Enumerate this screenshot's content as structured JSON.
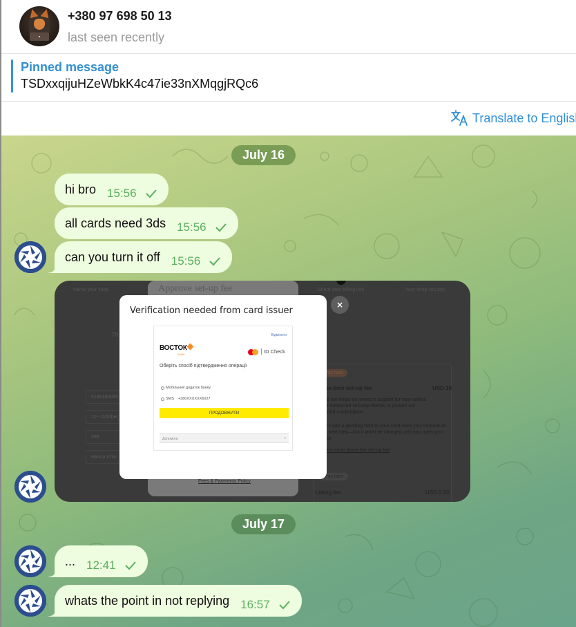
{
  "header": {
    "contact_name": "+380 97 698 50 13",
    "status": "last seen recently"
  },
  "pinned": {
    "title": "Pinned message",
    "text": "TSDxxqijuHZeWbkK4c47ie33nXMqgjRQc6"
  },
  "translate": {
    "label": "Translate to English"
  },
  "colors": {
    "accent": "#3390d0",
    "bubble": "#eefcdf",
    "time": "#5bb061",
    "bot_avatar": "#2c4d8e"
  },
  "chat": {
    "dates": [
      "July 16",
      "July 17"
    ],
    "messages": [
      {
        "text": "hi bro",
        "time": "15:56",
        "status": "sent"
      },
      {
        "text": "all cards need 3ds",
        "time": "15:56",
        "status": "sent"
      },
      {
        "text": "can you turn it off",
        "time": "15:56",
        "status": "sent"
      },
      {
        "text": "...",
        "time": "12:41",
        "status": "sent"
      },
      {
        "text": "whats the point in not replying",
        "time": "16:57",
        "status": "sent"
      }
    ]
  },
  "screenshot": {
    "steps": [
      "Name your shop",
      "Share your billing info",
      "Your shop security"
    ],
    "panel_title": "Approve set-up fee",
    "left_fragment": "Th",
    "fields": [
      "5168180035",
      "10 - October",
      "595",
      "Hanna Khin"
    ],
    "pay_now": "Pay now",
    "setup_fee_label": "One-time set-up fee",
    "setup_fee_value": "USD 19",
    "setup_fee_desc": "This fee helps us invest in support for new sellers and enhanced security checks to protect our trusted marketplace.",
    "hold_desc": "We'll add a pending hold to your card once you continue to the next step—but it won't be charged until you open your shop.",
    "learn_more": "Learn more about the set-up fee",
    "pay_later": "Pay later",
    "listing_fee_label": "Listing fee",
    "listing_fee_value": "USD 0.20",
    "fees_policy": "Fees & Payments Policy",
    "close": "×",
    "modal": {
      "title": "Verification needed from card issuer",
      "cancel": "Відмінити",
      "bank": "ВОСТОК",
      "bank_sub": "БАНК",
      "id_check": "ID Check",
      "choose": "Оберіть спосіб підтвердження операції",
      "option_app": "Мобільний додаток банку",
      "option_sms": "SMS",
      "sms_number": "+380XXXXXX6027",
      "continue": "ПРОДОВЖИТИ",
      "help": "Допомога",
      "help_chevron": "v"
    }
  }
}
